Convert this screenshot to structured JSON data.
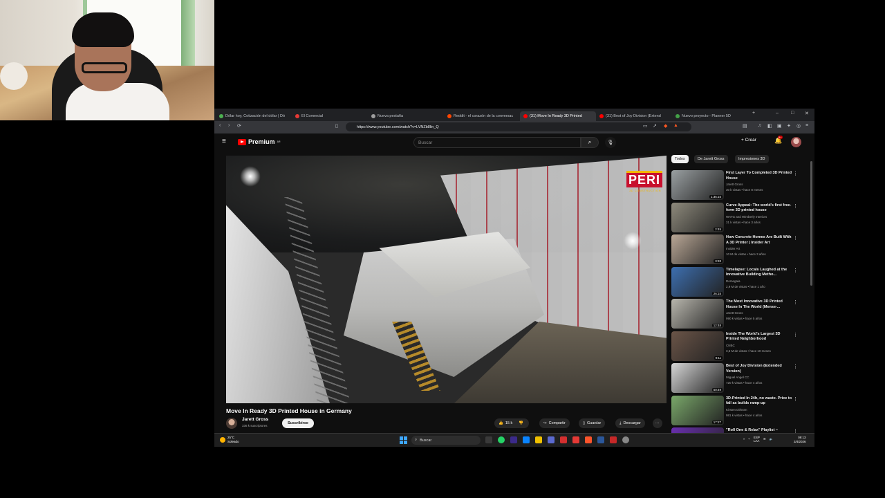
{
  "browser": {
    "tabs": [
      {
        "label": "Dólar hoy, Cotización del dólar | Dó",
        "color": "#4caf50",
        "active": false
      },
      {
        "label": "El Comercial",
        "color": "#e53935",
        "active": false
      },
      {
        "label": "Nueva pestaña",
        "color": "#9e9e9e",
        "active": false
      },
      {
        "label": "Reddit - el corazón de la conversac",
        "color": "#ff4500",
        "active": false
      },
      {
        "label": "(31) Move In Ready 3D Printed",
        "color": "#ff0000",
        "active": true
      },
      {
        "label": "(31) Best of Joy Division (Extend",
        "color": "#ff0000",
        "active": false
      },
      {
        "label": "Nuevo proyecto - Planner 5D",
        "color": "#43a047",
        "active": false
      }
    ],
    "url": "https://www.youtube.com/watch?v=LVNZb8lin_Q"
  },
  "youtube": {
    "logo_text": "Premium",
    "logo_sup": "AR",
    "search_placeholder": "Buscar",
    "create_label": "Crear",
    "notif_badge": "9+",
    "video": {
      "title": "Move In Ready 3D Printed House in Germany",
      "channel": "Jarett Gross",
      "subscribers": "336 k suscriptores",
      "subscribe_label": "Suscribirse",
      "likes": "15 k",
      "share_label": "Compartir",
      "save_label": "Guardar",
      "download_label": "Descargar",
      "overlay_logo": "PERI",
      "overlay_sub": "3D CONSTRUCTION"
    },
    "chips": [
      "Todos",
      "De Jarett Gross",
      "Impresiones 3D"
    ],
    "recommendations": [
      {
        "title": "First Layer To Completed 3D Printed House",
        "channel": "Jarett Gross",
        "meta": "30 k vistas • hace 8 meses",
        "duration": "1:35:15",
        "bg": "#9aa0a2"
      },
      {
        "title": "Curve Appeal: The world's first free-form 3D printed house",
        "channel": "WATG and Wimberly Interiors",
        "meta": "31 k vistas • hace 3 años",
        "duration": "2:45",
        "bg": "#8e8a7c"
      },
      {
        "title": "How Concrete Homes Are Built With A 3D Printer | Insider Art",
        "channel": "Insider Art",
        "meta": "10 M de vistas • hace 3 años",
        "duration": "3:33",
        "bg": "#b9a796"
      },
      {
        "title": "Timelapse: Locals Laughed at the Innovative Building Metho...",
        "channel": "Domegaia",
        "meta": "2,9 M de vistas • hace 1 año",
        "duration": "26:15",
        "bg": "#3d6fb0"
      },
      {
        "title": "The Most Innovative 3D Printed House In The World (Mense-...",
        "channel": "Jarett Gross",
        "meta": "990 k vistas • hace 5 años",
        "duration": "12:48",
        "bg": "#b8b6ad"
      },
      {
        "title": "Inside The World's Largest 3D Printed Neighborhood",
        "channel": "CNBC",
        "meta": "3,6 M de vistas • hace 10 meses",
        "duration": "9:11",
        "bg": "#6b5548"
      },
      {
        "title": "Best of Joy Division (Extended Version)",
        "channel": "Miguel Angel CC",
        "meta": "720 k vistas • hace 4 años",
        "duration": "50:49",
        "bg": "#d6d6d6"
      },
      {
        "title": "3D-Printed In 24h, no waste. Price to fall as builds ramp-up",
        "channel": "Kirsten Dirksen",
        "meta": "981 k vistas • hace 4 años",
        "duration": "17:27",
        "bg": "#7aa86a"
      },
      {
        "title": "\"Roll One & Relax\" Playlist ~",
        "channel": "",
        "meta": "",
        "duration": "",
        "bg": "#6a2fb0"
      }
    ]
  },
  "taskbar": {
    "temp": "25°C",
    "weather": "Soleado",
    "search_placeholder": "Buscar",
    "lang": "ESP",
    "lang2": "LAA",
    "time": "09:13",
    "date": "2/4/2026"
  }
}
